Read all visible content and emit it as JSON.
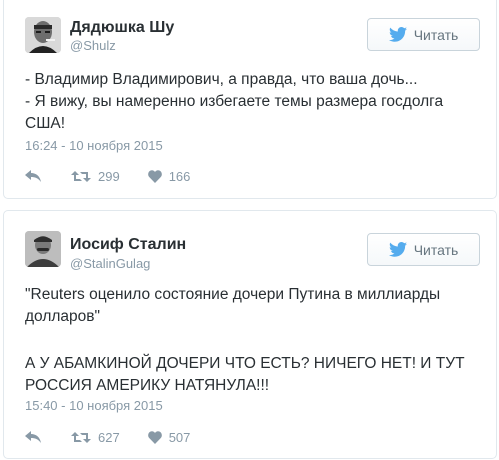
{
  "tweets": [
    {
      "name": "Дядюшка Шу",
      "handle": "@Shulz",
      "follow_label": "Читать",
      "text_lines": [
        "- Владимир Владимирович, а правда, что ваша дочь...",
        "- Я вижу, вы намеренно избегаете темы размера госдолга США!"
      ],
      "timestamp": "16:24 - 10 ноября 2015",
      "retweets": "299",
      "likes": "166"
    },
    {
      "name": "Иосиф Сталин",
      "handle": "@StalinGulag",
      "follow_label": "Читать",
      "text_lines": [
        "\"Reuters оценило состояние дочери Путина в миллиарды долларов\"",
        "А У АБАМКИНОЙ ДОЧЕРИ ЧТО ЕСТЬ? НИЧЕГО НЕТ! И ТУТ РОССИЯ АМЕРИКУ НАТЯНУЛА!!!"
      ],
      "timestamp": "15:40 - 10 ноября 2015",
      "retweets": "627",
      "likes": "507"
    }
  ],
  "icons": {
    "follow": "twitter-bird-icon",
    "reply": "reply-icon",
    "retweet": "retweet-icon",
    "like": "heart-icon"
  },
  "colors": {
    "name": "#292f33",
    "muted": "#8899a6",
    "twitter_blue": "#55acee",
    "border": "#e1e8ed"
  }
}
